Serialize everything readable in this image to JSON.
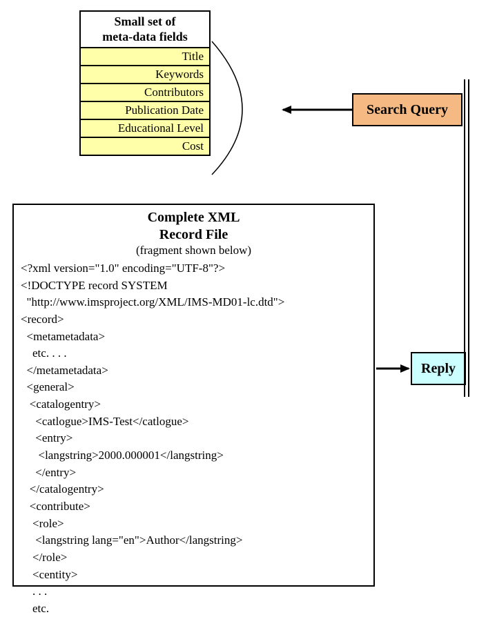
{
  "metadata": {
    "header_line1": "Small set of",
    "header_line2": "meta-data fields",
    "fields": [
      "Title",
      "Keywords",
      "Contributors",
      "Publication Date",
      "Educational Level",
      "Cost"
    ]
  },
  "search": {
    "label": "Search Query"
  },
  "reply": {
    "label": "Reply"
  },
  "xml": {
    "header_line1": "Complete XML",
    "header_line2": "Record File",
    "subtitle": "(fragment shown below)",
    "code": "<?xml version=\"1.0\" encoding=\"UTF-8\"?>\n<!DOCTYPE record SYSTEM\n  \"http://www.imsproject.org/XML/IMS-MD01-lc.dtd\">\n<record>\n  <metametadata>\n    etc. . . .\n  </metametadata>\n  <general>\n   <catalogentry>\n     <catlogue>IMS-Test</catlogue>\n     <entry>\n      <langstring>2000.000001</langstring>\n     </entry>\n   </catalogentry>\n   <contribute>\n    <role>\n     <langstring lang=\"en\">Author</langstring>\n    </role>\n    <centity>\n    . . .\n    etc."
  }
}
